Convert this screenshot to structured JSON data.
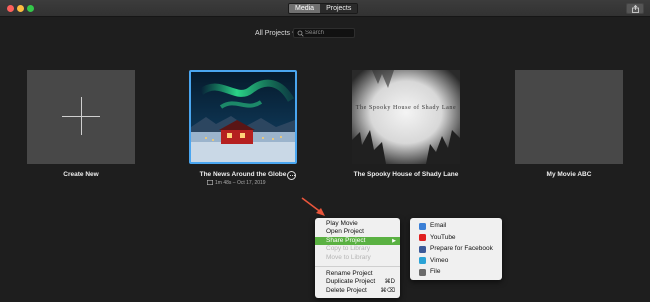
{
  "toolbar": {
    "tabs": [
      {
        "label": "Media",
        "active": true
      },
      {
        "label": "Projects",
        "active": false
      }
    ],
    "share_icon": "share-icon"
  },
  "filter": {
    "label": "All Projects",
    "search_placeholder": "Search"
  },
  "projects": [
    {
      "title": "Create New"
    },
    {
      "title": "The News Around the Globe",
      "meta": "1m 48s – Oct 17, 2019"
    },
    {
      "title": "The Spooky House of Shady Lane",
      "thumbnail_text": "The Spooky House of Shady Lane"
    },
    {
      "title": "My Movie ABC"
    }
  ],
  "context_menu": {
    "items": [
      {
        "label": "Play Movie",
        "enabled": true
      },
      {
        "label": "Open Project",
        "enabled": true
      },
      {
        "label": "Share Project",
        "enabled": true,
        "highlighted": true,
        "submenu": true
      },
      {
        "label": "Copy to Library",
        "enabled": false
      },
      {
        "label": "Move to Library",
        "enabled": false
      },
      {
        "label": "Rename Project",
        "enabled": true
      },
      {
        "label": "Duplicate Project",
        "enabled": true,
        "shortcut": "⌘D"
      },
      {
        "label": "Delete Project",
        "enabled": true,
        "shortcut": "⌘⌫"
      }
    ]
  },
  "share_submenu": {
    "items": [
      {
        "label": "Email",
        "icon": "email-icon",
        "color": "#3b7fd6"
      },
      {
        "label": "YouTube",
        "icon": "youtube-icon",
        "color": "#e02020"
      },
      {
        "label": "Prepare for Facebook",
        "icon": "facebook-icon",
        "color": "#3b5998"
      },
      {
        "label": "Vimeo",
        "icon": "vimeo-icon",
        "color": "#2ba3d6"
      },
      {
        "label": "File",
        "icon": "file-icon",
        "color": "#6a6a6a"
      }
    ]
  },
  "colors": {
    "accent": "#4aa6f0",
    "menu_highlight": "#5ab142",
    "annotation_arrow": "#e9553b"
  }
}
